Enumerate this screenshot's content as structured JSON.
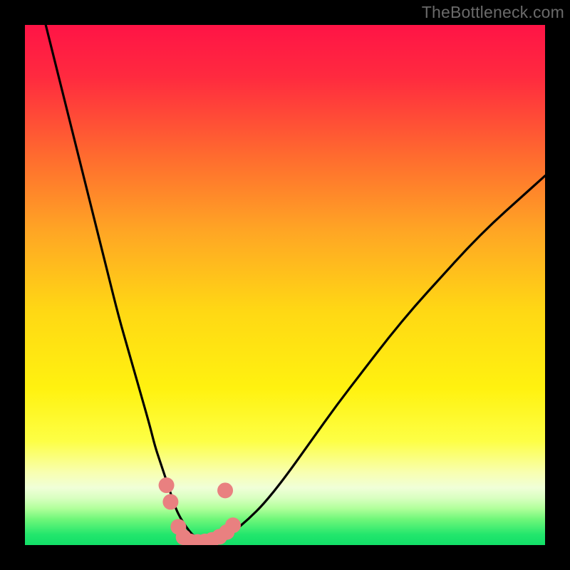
{
  "watermark": "TheBottleneck.com",
  "colors": {
    "gradient_stops": [
      {
        "offset": 0.0,
        "color": "#ff1446"
      },
      {
        "offset": 0.1,
        "color": "#ff2a3f"
      },
      {
        "offset": 0.25,
        "color": "#ff6a2f"
      },
      {
        "offset": 0.4,
        "color": "#ffa724"
      },
      {
        "offset": 0.55,
        "color": "#ffd814"
      },
      {
        "offset": 0.7,
        "color": "#fff210"
      },
      {
        "offset": 0.8,
        "color": "#fdff45"
      },
      {
        "offset": 0.86,
        "color": "#f8ffb0"
      },
      {
        "offset": 0.89,
        "color": "#f0ffd8"
      },
      {
        "offset": 0.91,
        "color": "#d8ffc0"
      },
      {
        "offset": 0.93,
        "color": "#b0ff9a"
      },
      {
        "offset": 0.95,
        "color": "#70f77a"
      },
      {
        "offset": 0.98,
        "color": "#22e66c"
      },
      {
        "offset": 1.0,
        "color": "#12df68"
      }
    ],
    "curve": "#000000",
    "marker_fill": "#e98080",
    "marker_stroke": "#a84c4c"
  },
  "chart_data": {
    "type": "line",
    "title": "",
    "xlabel": "",
    "ylabel": "",
    "xlim": [
      0,
      100
    ],
    "ylim": [
      0,
      100
    ],
    "series": [
      {
        "name": "bottleneck-curve",
        "x": [
          4,
          6,
          8,
          10,
          12,
          14,
          16,
          18,
          20,
          22,
          24,
          25,
          26,
          27,
          28,
          29,
          30,
          31,
          32,
          33,
          34,
          35,
          36,
          38,
          40,
          43,
          46,
          50,
          55,
          60,
          65,
          70,
          75,
          80,
          85,
          90,
          95,
          100
        ],
        "y": [
          100,
          92,
          84,
          76,
          68,
          60,
          52,
          44,
          37,
          30,
          23,
          19,
          16,
          13,
          10,
          7,
          5,
          3.5,
          2.2,
          1.3,
          0.7,
          0.5,
          0.6,
          1.2,
          2.5,
          5,
          8,
          13,
          20,
          27,
          33.5,
          40,
          46,
          51.5,
          57,
          62,
          66.5,
          71
        ]
      }
    ],
    "markers": [
      {
        "x": 27.2,
        "y": 11.5
      },
      {
        "x": 28.0,
        "y": 8.3
      },
      {
        "x": 29.5,
        "y": 3.5
      },
      {
        "x": 30.5,
        "y": 1.5
      },
      {
        "x": 31.8,
        "y": 0.7
      },
      {
        "x": 33.2,
        "y": 0.6
      },
      {
        "x": 34.6,
        "y": 0.7
      },
      {
        "x": 36.0,
        "y": 1.0
      },
      {
        "x": 37.4,
        "y": 1.6
      },
      {
        "x": 38.8,
        "y": 2.5
      },
      {
        "x": 40.0,
        "y": 3.8
      },
      {
        "x": 38.5,
        "y": 10.5
      }
    ]
  }
}
